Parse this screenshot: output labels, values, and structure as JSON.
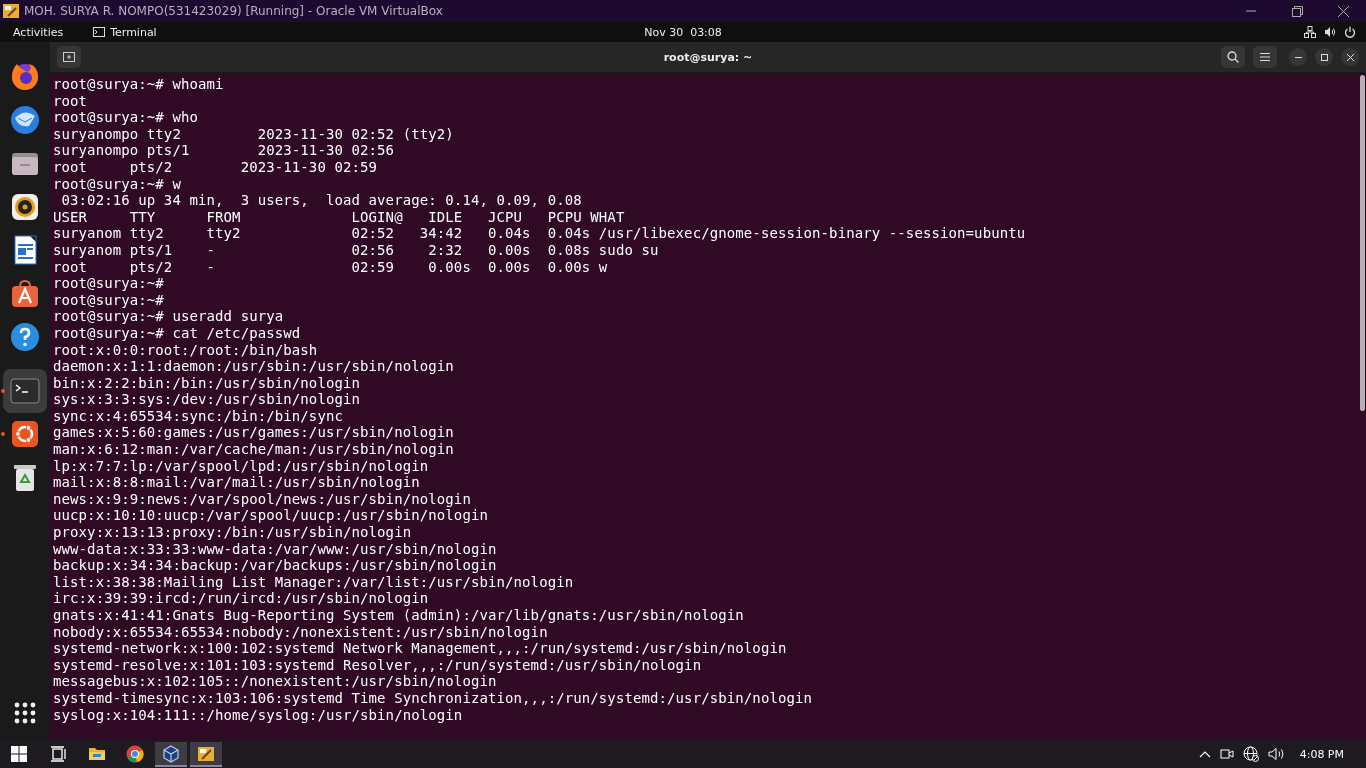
{
  "vm_window": {
    "title": "MOH. SURYA R. NOMPO(531423029) [Running] - Oracle VM VirtualBox"
  },
  "top_bar": {
    "activities": "Activities",
    "app_menu": "Terminal",
    "clock": "Nov 30  03:08"
  },
  "dock": {
    "items": [
      {
        "kind": "firefox",
        "running": false,
        "selected": false
      },
      {
        "kind": "mail",
        "running": false,
        "selected": false
      },
      {
        "kind": "files",
        "running": false,
        "selected": false
      },
      {
        "kind": "music",
        "running": false,
        "selected": false
      },
      {
        "kind": "document",
        "running": false,
        "selected": false
      },
      {
        "kind": "app-store",
        "running": false,
        "selected": false
      },
      {
        "kind": "help",
        "running": false,
        "selected": false
      },
      {
        "kind": "terminal",
        "running": true,
        "selected": true
      },
      {
        "kind": "ubuntu",
        "running": true,
        "selected": false
      },
      {
        "kind": "trash",
        "running": false,
        "selected": false
      }
    ]
  },
  "terminal": {
    "title": "root@surya: ~",
    "lines": [
      "root@surya:~# whoami",
      "root",
      "root@surya:~# who",
      "suryanompo tty2         2023-11-30 02:52 (tty2)",
      "suryanompo pts/1        2023-11-30 02:56",
      "root     pts/2        2023-11-30 02:59",
      "root@surya:~# w",
      " 03:02:16 up 34 min,  3 users,  load average: 0.14, 0.09, 0.08",
      "USER     TTY      FROM             LOGIN@   IDLE   JCPU   PCPU WHAT",
      "suryanom tty2     tty2             02:52   34:42   0.04s  0.04s /usr/libexec/gnome-session-binary --session=ubuntu",
      "suryanom pts/1    -                02:56    2:32   0.00s  0.08s sudo su",
      "root     pts/2    -                02:59    0.00s  0.00s  0.00s w",
      "root@surya:~#",
      "root@surya:~#",
      "root@surya:~# useradd surya",
      "root@surya:~# cat /etc/passwd",
      "root:x:0:0:root:/root:/bin/bash",
      "daemon:x:1:1:daemon:/usr/sbin:/usr/sbin/nologin",
      "bin:x:2:2:bin:/bin:/usr/sbin/nologin",
      "sys:x:3:3:sys:/dev:/usr/sbin/nologin",
      "sync:x:4:65534:sync:/bin:/bin/sync",
      "games:x:5:60:games:/usr/games:/usr/sbin/nologin",
      "man:x:6:12:man:/var/cache/man:/usr/sbin/nologin",
      "lp:x:7:7:lp:/var/spool/lpd:/usr/sbin/nologin",
      "mail:x:8:8:mail:/var/mail:/usr/sbin/nologin",
      "news:x:9:9:news:/var/spool/news:/usr/sbin/nologin",
      "uucp:x:10:10:uucp:/var/spool/uucp:/usr/sbin/nologin",
      "proxy:x:13:13:proxy:/bin:/usr/sbin/nologin",
      "www-data:x:33:33:www-data:/var/www:/usr/sbin/nologin",
      "backup:x:34:34:backup:/var/backups:/usr/sbin/nologin",
      "list:x:38:38:Mailing List Manager:/var/list:/usr/sbin/nologin",
      "irc:x:39:39:ircd:/run/ircd:/usr/sbin/nologin",
      "gnats:x:41:41:Gnats Bug-Reporting System (admin):/var/lib/gnats:/usr/sbin/nologin",
      "nobody:x:65534:65534:nobody:/nonexistent:/usr/sbin/nologin",
      "systemd-network:x:100:102:systemd Network Management,,,:/run/systemd:/usr/sbin/nologin",
      "systemd-resolve:x:101:103:systemd Resolver,,,:/run/systemd:/usr/sbin/nologin",
      "messagebus:x:102:105::/nonexistent:/usr/sbin/nologin",
      "systemd-timesync:x:103:106:systemd Time Synchronization,,,:/run/systemd:/usr/sbin/nologin",
      "syslog:x:104:111::/home/syslog:/usr/sbin/nologin"
    ]
  },
  "taskbar": {
    "items": [
      {
        "kind": "start",
        "selected": false
      },
      {
        "kind": "task-view",
        "selected": false
      },
      {
        "kind": "folder",
        "selected": false
      },
      {
        "kind": "browser",
        "selected": false
      },
      {
        "kind": "cube",
        "selected": true
      },
      {
        "kind": "vm",
        "selected": true
      }
    ],
    "clock": "4:08 PM"
  }
}
